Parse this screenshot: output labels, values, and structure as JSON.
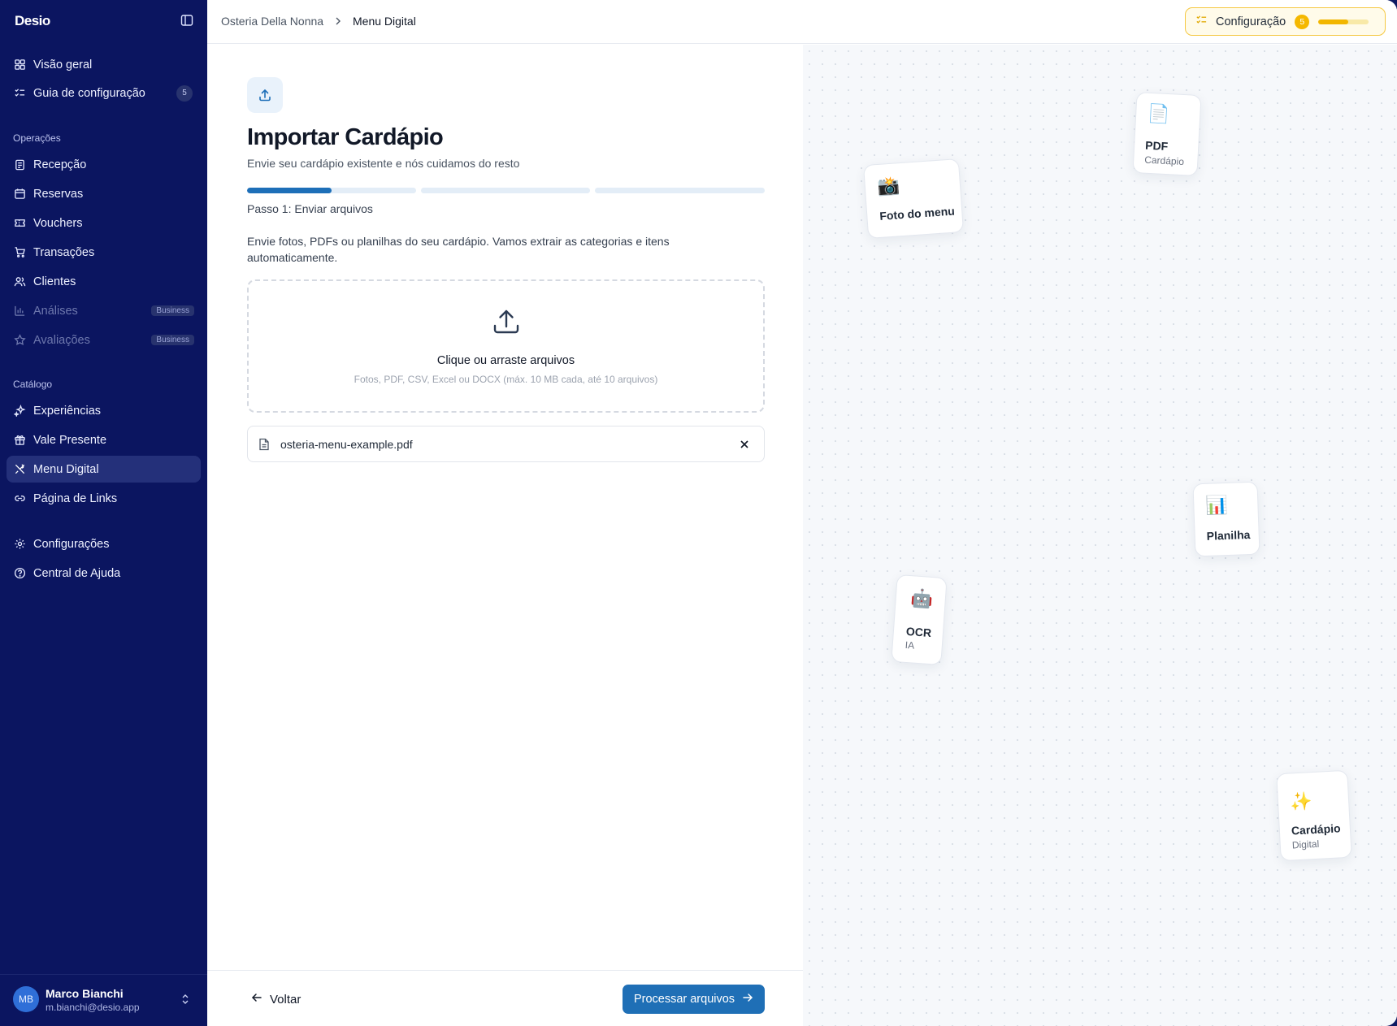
{
  "app": {
    "brand": "Desio"
  },
  "sidebar": {
    "items": [
      {
        "label": "Visão geral"
      },
      {
        "label": "Guia de configuração",
        "badge": "5"
      }
    ],
    "sections": [
      {
        "title": "Operações",
        "items": [
          {
            "label": "Recepção"
          },
          {
            "label": "Reservas"
          },
          {
            "label": "Vouchers"
          },
          {
            "label": "Transações"
          },
          {
            "label": "Clientes"
          },
          {
            "label": "Análises",
            "tag": "Business"
          },
          {
            "label": "Avaliações",
            "tag": "Business"
          }
        ]
      },
      {
        "title": "Catálogo",
        "items": [
          {
            "label": "Experiências"
          },
          {
            "label": "Vale Presente"
          },
          {
            "label": "Menu Digital",
            "active": true
          },
          {
            "label": "Página de Links"
          }
        ]
      }
    ],
    "bottom_items": [
      {
        "label": "Configurações"
      },
      {
        "label": "Central de Ajuda"
      }
    ],
    "user": {
      "initials": "MB",
      "name": "Marco Bianchi",
      "email": "m.bianchi@desio.app"
    }
  },
  "header": {
    "breadcrumb": [
      "Osteria Della Nonna",
      "Menu Digital"
    ],
    "config": {
      "label": "Configuração",
      "badge": "5",
      "progress": 0.6
    }
  },
  "main": {
    "title": "Importar Cardápio",
    "subtitle": "Envie seu cardápio existente e nós cuidamos do resto",
    "steps": {
      "total": 3,
      "current": 1,
      "current_fill": 0.5
    },
    "step_label": "Passo 1: Enviar arquivos",
    "description": "Envie fotos, PDFs ou planilhas do seu cardápio. Vamos extrair as categorias e itens automaticamente.",
    "dropzone": {
      "title": "Clique ou arraste arquivos",
      "hint": "Fotos, PDF, CSV, Excel ou DOCX (máx. 10 MB cada, até 10 arquivos)"
    },
    "file": {
      "name": "osteria-menu-example.pdf"
    },
    "footer": {
      "back_label": "Voltar",
      "primary_label": "Processar arquivos"
    }
  },
  "illustration": {
    "cards": [
      {
        "icon": "page-emoji",
        "glyph": "📄",
        "title": "PDF",
        "subtitle": "Cardápio"
      },
      {
        "icon": "camera-emoji",
        "glyph": "📸",
        "title": "Foto do menu",
        "subtitle": ""
      },
      {
        "icon": "chart-emoji",
        "glyph": "📊",
        "title": "Planilha",
        "subtitle": ""
      },
      {
        "icon": "robot-emoji",
        "glyph": "🤖",
        "title": "OCR",
        "subtitle": "IA"
      },
      {
        "icon": "sparkles-emoji",
        "glyph": "✨",
        "title": "Cardápio",
        "subtitle": "Digital"
      }
    ]
  },
  "colors": {
    "sidebar_bg": "#0b1560",
    "primary": "#1f6fb6",
    "config_accent": "#f2b600"
  }
}
